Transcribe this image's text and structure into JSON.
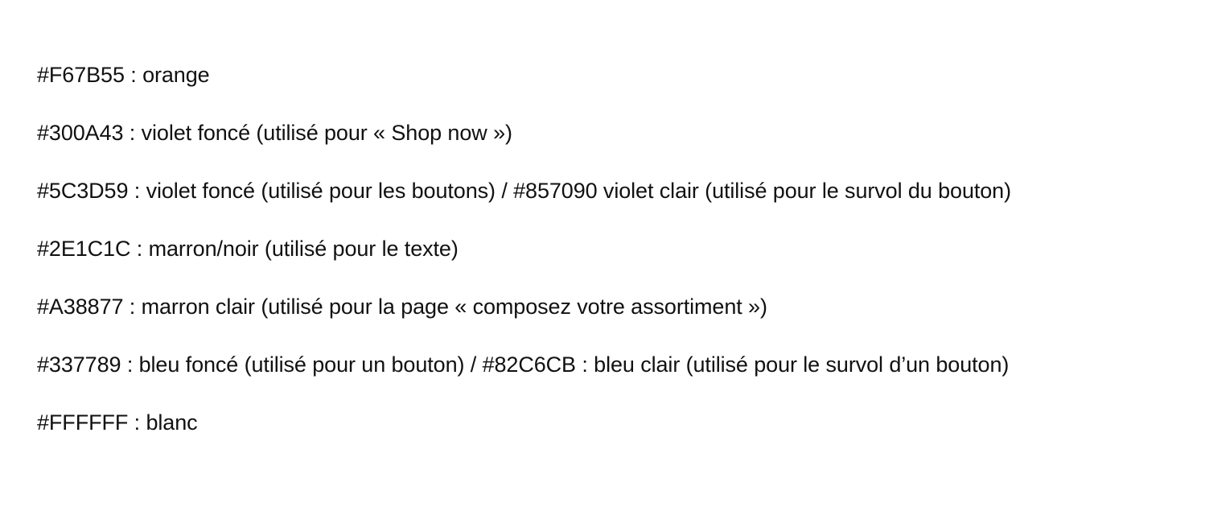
{
  "document": {
    "lines": [
      "#F67B55 : orange",
      "#300A43 : violet foncé (utilisé pour « Shop now »)",
      "#5C3D59 : violet foncé (utilisé pour les boutons) / #857090 violet clair (utilisé pour le survol du bouton)",
      "#2E1C1C : marron/noir (utilisé pour le texte)",
      "#A38877 : marron clair (utilisé pour la page « composez votre assortiment »)",
      "#337789 : bleu foncé (utilisé pour un bouton) / #82C6CB : bleu clair (utilisé pour le survol d’un bouton)",
      "#FFFFFF : blanc"
    ]
  }
}
